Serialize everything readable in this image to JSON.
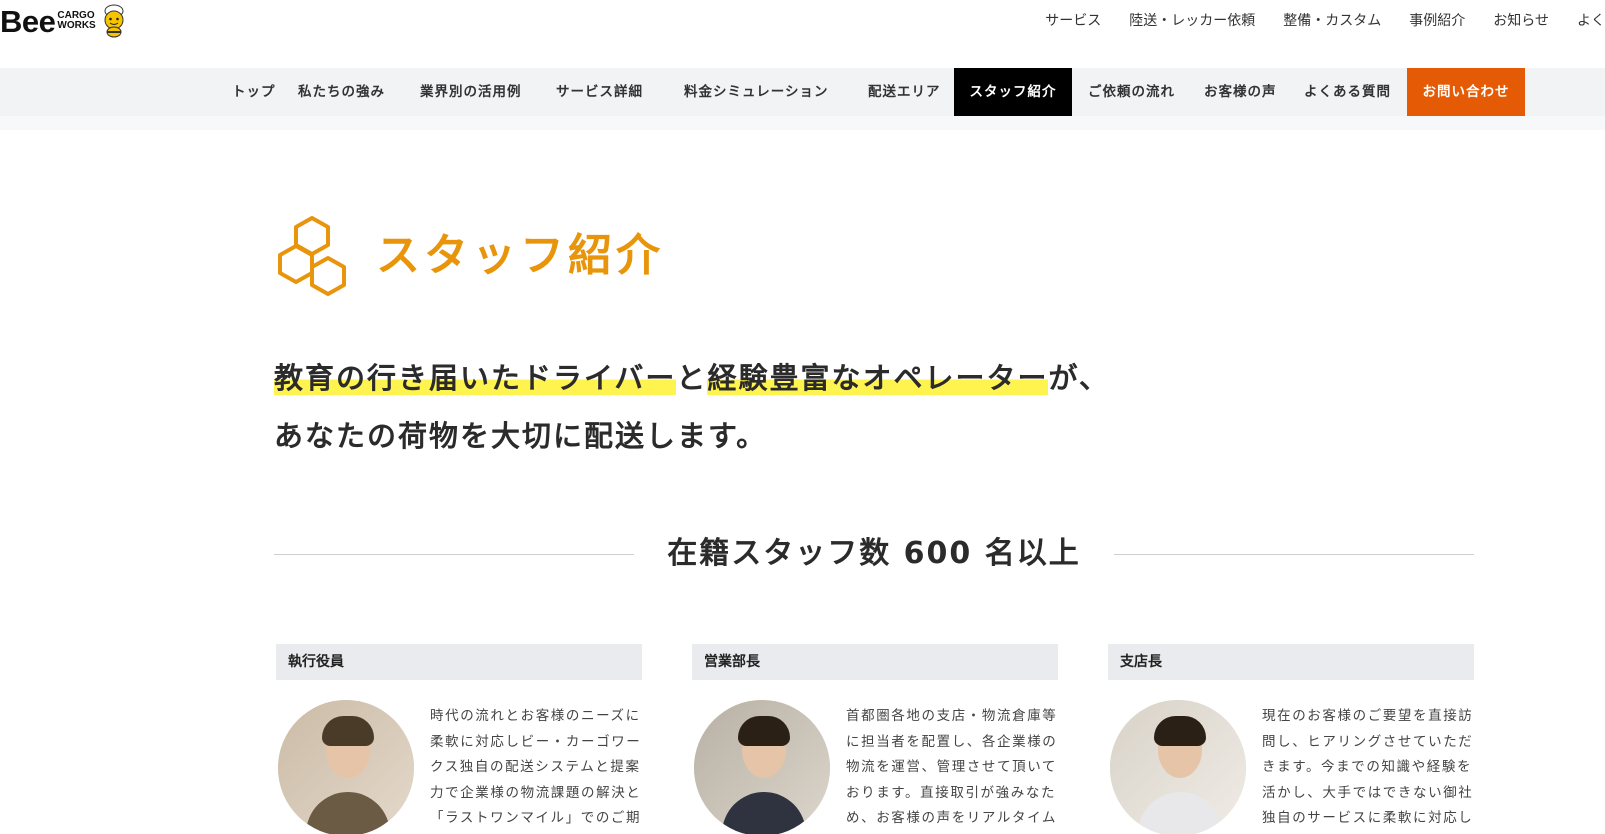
{
  "logo": {
    "main": "Bee",
    "sub_top": "CARGO",
    "sub_bottom": "WORKS"
  },
  "top_nav": [
    "サービス",
    "陸送・レッカー依頼",
    "整備・カスタム",
    "事例紹介",
    "お知らせ",
    "よく"
  ],
  "main_nav": {
    "items": [
      "トップ",
      "私たちの強み",
      "業界別の活用例",
      "サービス詳細",
      "料金シミュレーション",
      "配送エリア",
      "スタッフ紹介",
      "ご依頼の流れ",
      "お客様の声",
      "よくある質問"
    ],
    "active": "スタッフ紹介",
    "contact": "お問い合わせ"
  },
  "section": {
    "title": "スタッフ紹介"
  },
  "lead": {
    "line1_a": "教育の行き届いたドライバー",
    "line1_b": "と",
    "line1_c": "経験豊富なオペレーター",
    "line1_d": "が、",
    "line2": "あなたの荷物を大切に配送します。"
  },
  "staff_count": "在籍スタッフ数 600 名以上",
  "staff": [
    {
      "role": "執行役員",
      "text": "時代の流れとお客様のニーズに柔軟に対応しビー・カーゴワークス独自の配送システムと提案力で企業様の物流課題の解決と「ラストワンマイル」でのご期待に応えております。今後も"
    },
    {
      "role": "営業部長",
      "text": "首都圏各地の支店・物流倉庫等に担当者を配置し、各企業様の物流を運営、管理させて頂いております。直接取引が強みなため、お客様の声をリアルタイムに現場へ共有し配送課題を解"
    },
    {
      "role": "支店長",
      "text": "現在のお客様のご要望を直接訪問し、ヒアリングさせていただきます。今までの知識や経験を活かし、大手ではできない御社独自のサービスに柔軟に対応していけるようお客様の声を大切"
    }
  ],
  "colors": {
    "accent_orange": "#e8950c",
    "contact_orange": "#e55a05",
    "highlight_yellow": "#fff44f",
    "nav_bg": "#f2f3f5",
    "card_head_bg": "#e9ebee"
  }
}
